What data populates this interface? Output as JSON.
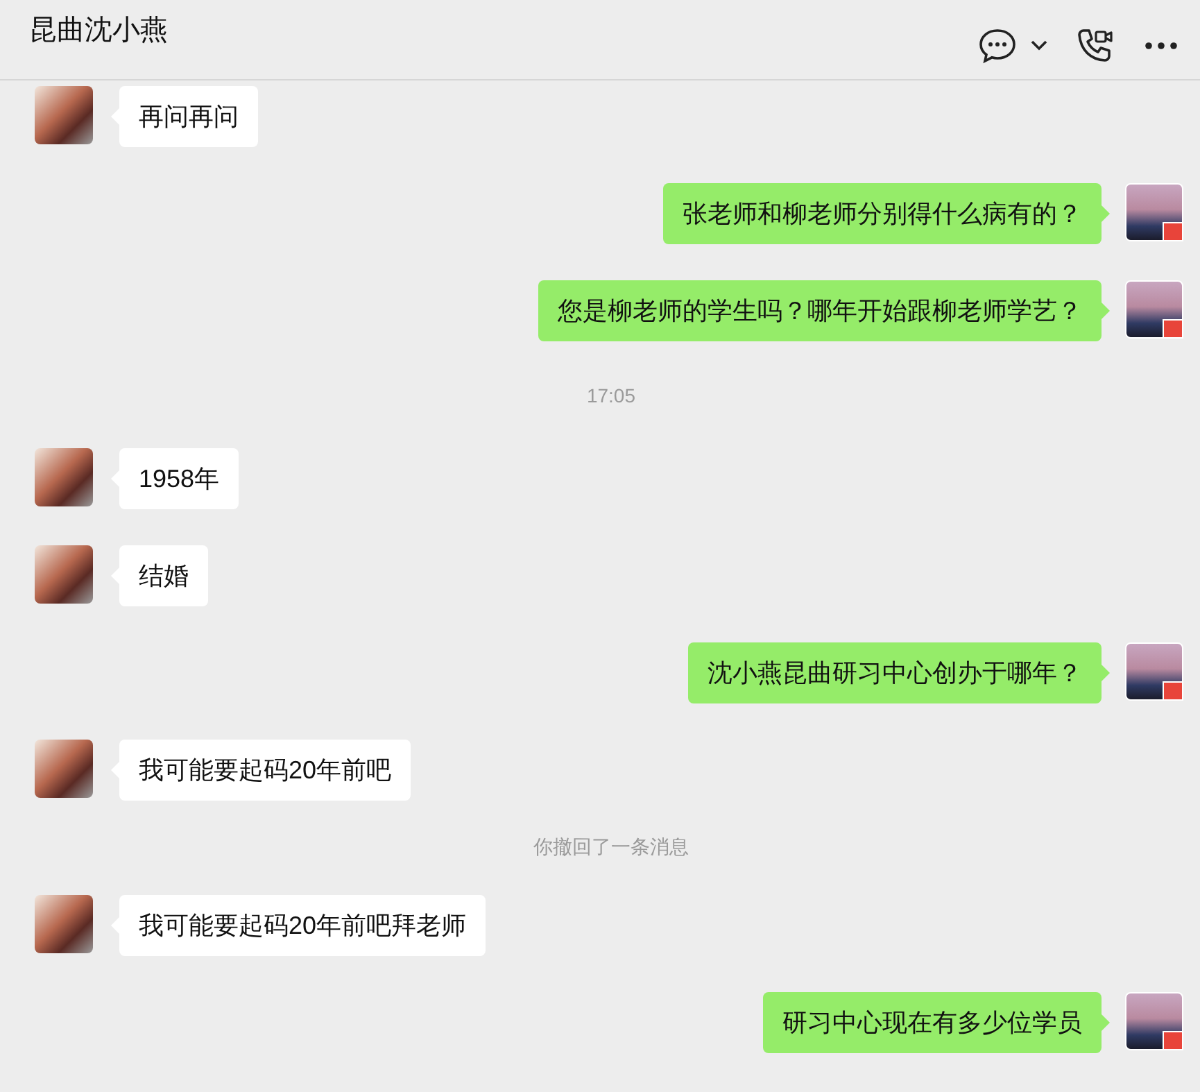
{
  "header": {
    "title": "昆曲沈小燕"
  },
  "messages": [
    {
      "kind": "received",
      "text": "再问再问"
    },
    {
      "kind": "sent",
      "text": "张老师和柳老师分别得什么病有的？"
    },
    {
      "kind": "sent",
      "text": "您是柳老师的学生吗？哪年开始跟柳老师学艺？"
    },
    {
      "kind": "time",
      "text": "17:05"
    },
    {
      "kind": "received",
      "text": "1958年"
    },
    {
      "kind": "received",
      "text": "结婚"
    },
    {
      "kind": "sent",
      "text": "沈小燕昆曲研习中心创办于哪年？"
    },
    {
      "kind": "received",
      "text": "我可能要起码20年前吧"
    },
    {
      "kind": "notice",
      "text": "你撤回了一条消息"
    },
    {
      "kind": "received",
      "text": "我可能要起码20年前吧拜老师"
    },
    {
      "kind": "sent",
      "text": "研习中心现在有多少位学员"
    }
  ]
}
